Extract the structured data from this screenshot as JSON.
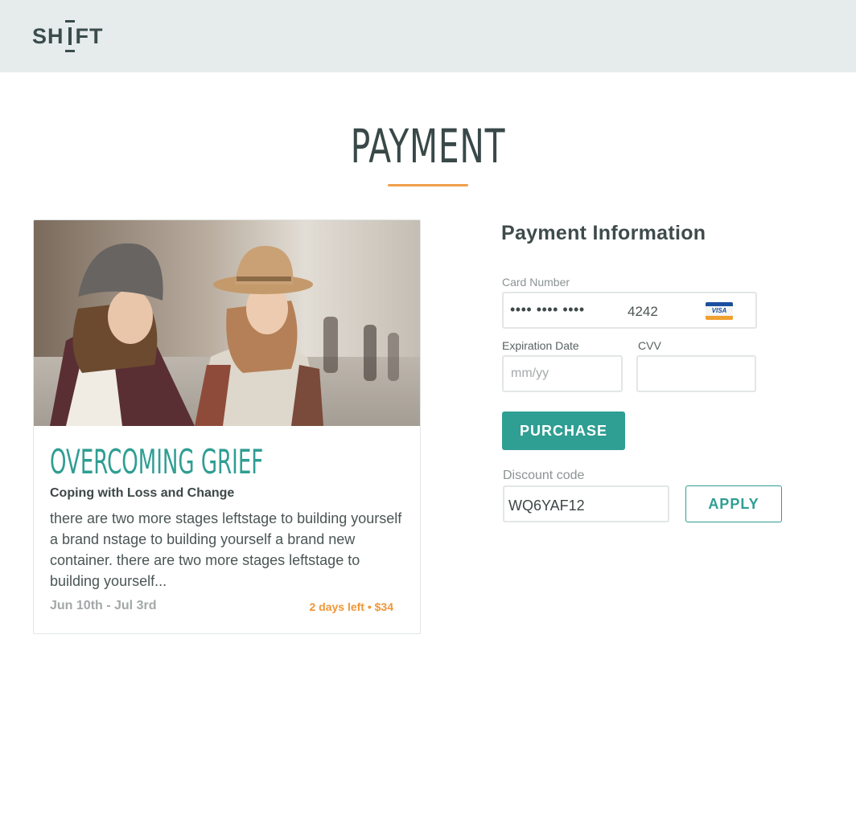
{
  "header": {
    "logo": {
      "left": "SH",
      "right": "FT"
    }
  },
  "page": {
    "title": "PAYMENT"
  },
  "course": {
    "title": "OVERCOMING GRIEF",
    "subtitle": "Coping with Loss and Change",
    "description": "there are two more stages leftstage to building yourself a brand nstage to building yourself a brand new container. there are two more stages leftstage to building yourself...",
    "dates": "Jun 10th - Jul 3rd",
    "meta": "2 days left • $34"
  },
  "payment": {
    "heading": "Payment Information",
    "card_number_label": "Card Number",
    "card_masked": "•••• •••• ••••",
    "card_last4": "4242",
    "card_brand": "VISA",
    "expiration_label": "Expiration Date",
    "expiration_placeholder": "mm/yy",
    "cvv_label": "CVV",
    "cvv_value": "",
    "purchase_label": "PURCHASE",
    "discount_label": "Discount code",
    "discount_value": "WQ6YAF12",
    "apply_label": "APPLY"
  },
  "colors": {
    "accent_teal": "#2f9e93",
    "accent_orange": "#f0a04b",
    "topbar_bg": "#e6ebeb"
  }
}
